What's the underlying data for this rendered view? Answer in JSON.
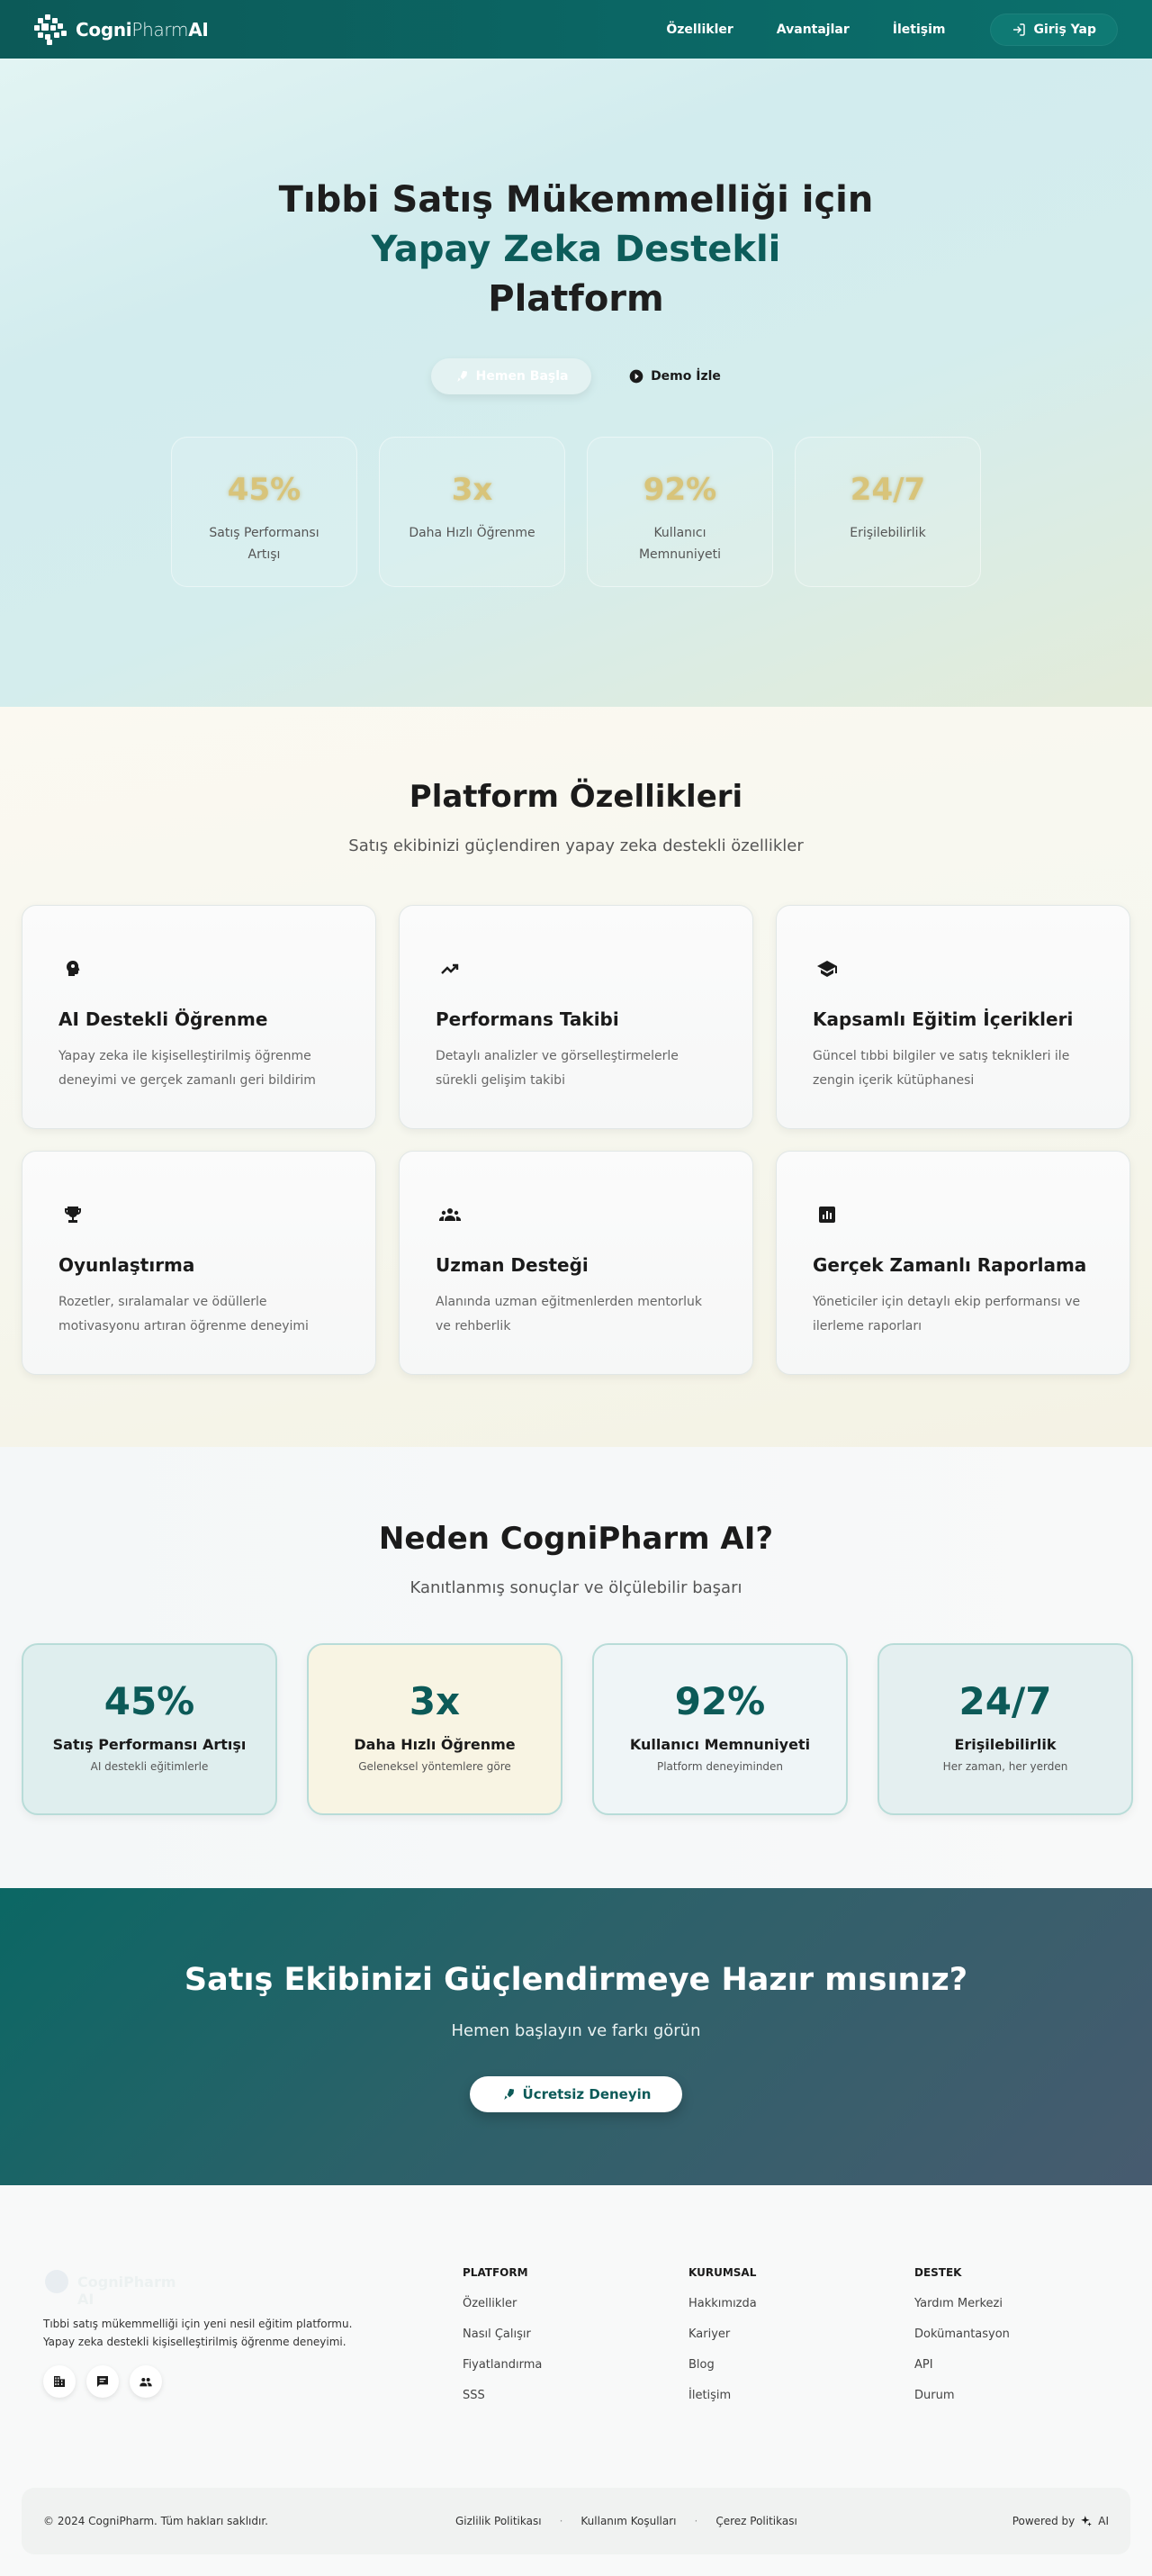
{
  "nav": {
    "logo_bold": "Cogni",
    "logo_thin": "Pharm",
    "logo_ai": "AI",
    "links": [
      {
        "label": "Özellikler"
      },
      {
        "label": "Avantajlar"
      },
      {
        "label": "İletişim"
      }
    ],
    "login_label": "Giriş Yap"
  },
  "hero": {
    "title_line1": "Tıbbi Satış Mükemmelliği için",
    "title_line2": "Yapay Zeka Destekli",
    "title_line3": "Platform",
    "primary_cta": "Hemen Başla",
    "demo_cta": "Demo İzle",
    "stats": [
      {
        "value": "45%",
        "label": "Satış Performansı Artışı"
      },
      {
        "value": "3x",
        "label": "Daha Hızlı Öğrenme"
      },
      {
        "value": "92%",
        "label": "Kullanıcı Memnuniyeti"
      },
      {
        "value": "24/7",
        "label": "Erişilebilirlik"
      }
    ]
  },
  "features": {
    "title": "Platform Özellikleri",
    "subtitle": "Satış ekibinizi güçlendiren yapay zeka destekli özellikler",
    "items": [
      {
        "icon": "brain-head-icon",
        "title": "AI Destekli Öğrenme",
        "desc": "Yapay zeka ile kişiselleştirilmiş öğrenme deneyimi ve gerçek zamanlı geri bildirim"
      },
      {
        "icon": "trending-up-icon",
        "title": "Performans Takibi",
        "desc": "Detaylı analizler ve görselleştirmelerle sürekli gelişim takibi"
      },
      {
        "icon": "graduation-cap-icon",
        "title": "Kapsamlı Eğitim İçerikleri",
        "desc": "Güncel tıbbi bilgiler ve satış teknikleri ile zengin içerik kütüphanesi"
      },
      {
        "icon": "trophy-icon",
        "title": "Oyunlaştırma",
        "desc": "Rozetler, sıralamalar ve ödüllerle motivasyonu artıran öğrenme deneyimi"
      },
      {
        "icon": "group-icon",
        "title": "Uzman Desteği",
        "desc": "Alanında uzman eğitmenlerden mentorluk ve rehberlik"
      },
      {
        "icon": "bar-chart-icon",
        "title": "Gerçek Zamanlı Raporlama",
        "desc": "Yöneticiler için detaylı ekip performansı ve ilerleme raporları"
      }
    ]
  },
  "why": {
    "title": "Neden CogniPharm AI?",
    "subtitle": "Kanıtlanmış sonuçlar ve ölçülebilir başarı",
    "cards": [
      {
        "value": "45%",
        "title": "Satış Performansı Artışı",
        "sub": "AI destekli eğitimlerle",
        "bg": "#dfeeee"
      },
      {
        "value": "3x",
        "title": "Daha Hızlı Öğrenme",
        "sub": "Geleneksel yöntemlere göre",
        "bg": "#f8f4e3"
      },
      {
        "value": "92%",
        "title": "Kullanıcı Memnuniyeti",
        "sub": "Platform deneyiminden",
        "bg": "#eff5f7"
      },
      {
        "value": "24/7",
        "title": "Erişilebilirlik",
        "sub": "Her zaman, her yerden",
        "bg": "#e4eff0"
      }
    ]
  },
  "cta": {
    "title": "Satış Ekibinizi Güçlendirmeye Hazır mısınız?",
    "subtitle": "Hemen başlayın ve farkı görün",
    "button": "Ücretsiz Deneyin"
  },
  "footer": {
    "logo_text": "CogniPharm AI",
    "desc": "Tıbbi satış mükemmelliği için yeni nesil eğitim platformu. Yapay zeka destekli kişiselleştirilmiş öğrenme deneyimi.",
    "columns": [
      {
        "head": "PLATFORM",
        "items": [
          "Özellikler",
          "Nasıl Çalışır",
          "Fiyatlandırma",
          "SSS"
        ]
      },
      {
        "head": "KURUMSAL",
        "items": [
          "Hakkımızda",
          "Kariyer",
          "Blog",
          "İletişim"
        ]
      },
      {
        "head": "DESTEK",
        "items": [
          "Yardım Merkezi",
          "Dokümantasyon",
          "API",
          "Durum"
        ]
      }
    ],
    "copyright": "© 2024 CogniPharm. Tüm hakları saklıdır.",
    "legal": [
      "Gizlilik Politikası",
      "Kullanım Koşulları",
      "Çerez Politikası"
    ],
    "powered_by": "Powered by",
    "powered_ai": "AI"
  }
}
